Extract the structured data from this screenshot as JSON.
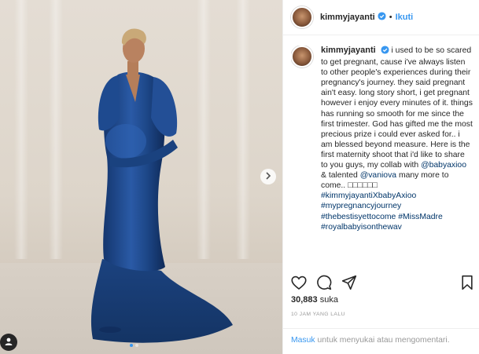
{
  "post": {
    "author": "kimmyjayanti",
    "separator": "•",
    "follow_label": "Ikuti",
    "caption": "i used to be so scared to get pregnant, cause i've always listen to other people's experiences during their pregnancy's journey. they said pregnant ain't easy. long story short, i get pregnant however i enjoy every minutes of it. things has running so smooth for me since the first trimester. God has gifted me the most precious prize i could ever asked for.. i am blessed beyond measure. Here is the first maternity shoot that i'd like to share to you guys, my collab with",
    "mention1": "@babyaxioo",
    "and_text": "& talented",
    "mention2": "@vaniova",
    "more_text": "many more to come.. □□□□□□",
    "hashtags": [
      "#kimmyjayantiXbabyAxioo",
      "#mypregnancyjourney",
      "#thebestisyettocome",
      "#MissMadre",
      "#royalbabyisonthewav"
    ],
    "likes_count": "30,883",
    "likes_label": "suka",
    "time_ago": "10 JAM YANG LALU"
  },
  "footer": {
    "login_label": "Masuk",
    "prompt": "untuk menyukai atau mengomentari."
  },
  "icons": {
    "heart": "heart-icon",
    "comment": "comment-icon",
    "share": "share-icon",
    "bookmark": "bookmark-icon",
    "verified": "verified-badge-icon",
    "next": "chevron-right-icon",
    "user_tag": "user-tag-icon"
  },
  "colors": {
    "link_blue": "#3897f0",
    "hashtag_blue": "#003569",
    "dress_blue": "#1e4a8f"
  },
  "carousel": {
    "count": 2,
    "active_index": 1
  }
}
